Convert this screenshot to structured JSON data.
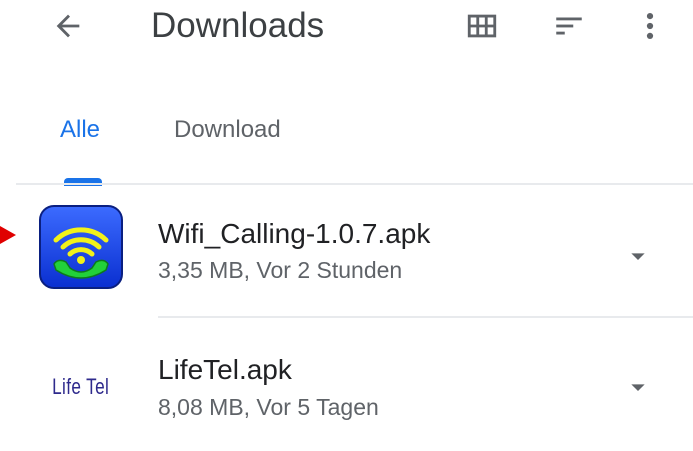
{
  "app_bar": {
    "title": "Downloads",
    "back_icon": "arrow-back-icon",
    "grid_icon": "grid-view-icon",
    "sort_icon": "sort-icon",
    "more_icon": "more-vert-icon"
  },
  "tabs": [
    {
      "label": "Alle",
      "selected": true
    },
    {
      "label": "Download",
      "selected": false
    }
  ],
  "files": [
    {
      "name": "Wifi_Calling-1.0.7.apk",
      "meta": "3,35 MB, Vor 2 Stunden",
      "icon": "wifi-calling-app-icon"
    },
    {
      "name": "LifeTel.apk",
      "meta": "8,08 MB, Vor 5 Tagen",
      "icon": "lifetel-logo-icon",
      "logo_text": "Life Tel"
    }
  ],
  "colors": {
    "accent": "#1a73e8",
    "text_primary": "#202124",
    "text_secondary": "#5f6368",
    "annotation_arrow": "#e00000"
  }
}
